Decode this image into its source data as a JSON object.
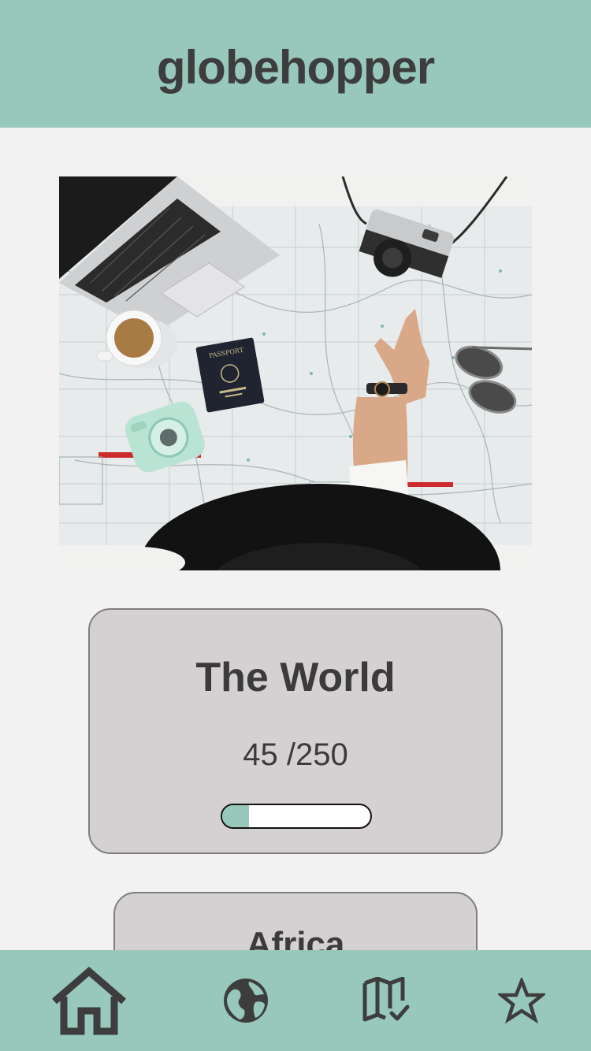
{
  "app": {
    "title": "globehopper"
  },
  "hero": {
    "image": "travel-planning-map-photo"
  },
  "cards": [
    {
      "name": "The World",
      "count_text": "45 /250",
      "progress": 0.18
    },
    {
      "name": "Africa"
    }
  ],
  "nav": {
    "items": [
      {
        "icon": "home-icon",
        "active": true
      },
      {
        "icon": "globe-icon"
      },
      {
        "icon": "map-check-icon"
      },
      {
        "icon": "star-icon"
      }
    ]
  },
  "colors": {
    "accent": "#98c7bb",
    "background": "#f2f2f2",
    "card": "#d5d1d2",
    "text": "#3d3d3d"
  }
}
